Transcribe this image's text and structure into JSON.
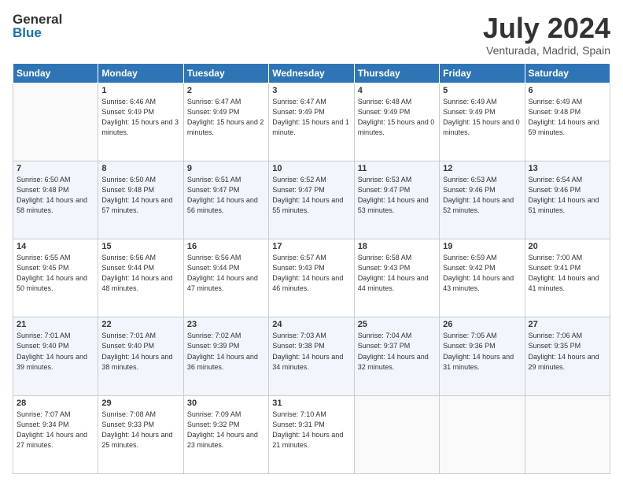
{
  "logo": {
    "general": "General",
    "blue": "Blue"
  },
  "title": "July 2024",
  "subtitle": "Venturada, Madrid, Spain",
  "days_of_week": [
    "Sunday",
    "Monday",
    "Tuesday",
    "Wednesday",
    "Thursday",
    "Friday",
    "Saturday"
  ],
  "weeks": [
    [
      {
        "day": "",
        "sunrise": "",
        "sunset": "",
        "daylight": ""
      },
      {
        "day": "1",
        "sunrise": "Sunrise: 6:46 AM",
        "sunset": "Sunset: 9:49 PM",
        "daylight": "Daylight: 15 hours and 3 minutes."
      },
      {
        "day": "2",
        "sunrise": "Sunrise: 6:47 AM",
        "sunset": "Sunset: 9:49 PM",
        "daylight": "Daylight: 15 hours and 2 minutes."
      },
      {
        "day": "3",
        "sunrise": "Sunrise: 6:47 AM",
        "sunset": "Sunset: 9:49 PM",
        "daylight": "Daylight: 15 hours and 1 minute."
      },
      {
        "day": "4",
        "sunrise": "Sunrise: 6:48 AM",
        "sunset": "Sunset: 9:49 PM",
        "daylight": "Daylight: 15 hours and 0 minutes."
      },
      {
        "day": "5",
        "sunrise": "Sunrise: 6:49 AM",
        "sunset": "Sunset: 9:49 PM",
        "daylight": "Daylight: 15 hours and 0 minutes."
      },
      {
        "day": "6",
        "sunrise": "Sunrise: 6:49 AM",
        "sunset": "Sunset: 9:48 PM",
        "daylight": "Daylight: 14 hours and 59 minutes."
      }
    ],
    [
      {
        "day": "7",
        "sunrise": "Sunrise: 6:50 AM",
        "sunset": "Sunset: 9:48 PM",
        "daylight": "Daylight: 14 hours and 58 minutes."
      },
      {
        "day": "8",
        "sunrise": "Sunrise: 6:50 AM",
        "sunset": "Sunset: 9:48 PM",
        "daylight": "Daylight: 14 hours and 57 minutes."
      },
      {
        "day": "9",
        "sunrise": "Sunrise: 6:51 AM",
        "sunset": "Sunset: 9:47 PM",
        "daylight": "Daylight: 14 hours and 56 minutes."
      },
      {
        "day": "10",
        "sunrise": "Sunrise: 6:52 AM",
        "sunset": "Sunset: 9:47 PM",
        "daylight": "Daylight: 14 hours and 55 minutes."
      },
      {
        "day": "11",
        "sunrise": "Sunrise: 6:53 AM",
        "sunset": "Sunset: 9:47 PM",
        "daylight": "Daylight: 14 hours and 53 minutes."
      },
      {
        "day": "12",
        "sunrise": "Sunrise: 6:53 AM",
        "sunset": "Sunset: 9:46 PM",
        "daylight": "Daylight: 14 hours and 52 minutes."
      },
      {
        "day": "13",
        "sunrise": "Sunrise: 6:54 AM",
        "sunset": "Sunset: 9:46 PM",
        "daylight": "Daylight: 14 hours and 51 minutes."
      }
    ],
    [
      {
        "day": "14",
        "sunrise": "Sunrise: 6:55 AM",
        "sunset": "Sunset: 9:45 PM",
        "daylight": "Daylight: 14 hours and 50 minutes."
      },
      {
        "day": "15",
        "sunrise": "Sunrise: 6:56 AM",
        "sunset": "Sunset: 9:44 PM",
        "daylight": "Daylight: 14 hours and 48 minutes."
      },
      {
        "day": "16",
        "sunrise": "Sunrise: 6:56 AM",
        "sunset": "Sunset: 9:44 PM",
        "daylight": "Daylight: 14 hours and 47 minutes."
      },
      {
        "day": "17",
        "sunrise": "Sunrise: 6:57 AM",
        "sunset": "Sunset: 9:43 PM",
        "daylight": "Daylight: 14 hours and 46 minutes."
      },
      {
        "day": "18",
        "sunrise": "Sunrise: 6:58 AM",
        "sunset": "Sunset: 9:43 PM",
        "daylight": "Daylight: 14 hours and 44 minutes."
      },
      {
        "day": "19",
        "sunrise": "Sunrise: 6:59 AM",
        "sunset": "Sunset: 9:42 PM",
        "daylight": "Daylight: 14 hours and 43 minutes."
      },
      {
        "day": "20",
        "sunrise": "Sunrise: 7:00 AM",
        "sunset": "Sunset: 9:41 PM",
        "daylight": "Daylight: 14 hours and 41 minutes."
      }
    ],
    [
      {
        "day": "21",
        "sunrise": "Sunrise: 7:01 AM",
        "sunset": "Sunset: 9:40 PM",
        "daylight": "Daylight: 14 hours and 39 minutes."
      },
      {
        "day": "22",
        "sunrise": "Sunrise: 7:01 AM",
        "sunset": "Sunset: 9:40 PM",
        "daylight": "Daylight: 14 hours and 38 minutes."
      },
      {
        "day": "23",
        "sunrise": "Sunrise: 7:02 AM",
        "sunset": "Sunset: 9:39 PM",
        "daylight": "Daylight: 14 hours and 36 minutes."
      },
      {
        "day": "24",
        "sunrise": "Sunrise: 7:03 AM",
        "sunset": "Sunset: 9:38 PM",
        "daylight": "Daylight: 14 hours and 34 minutes."
      },
      {
        "day": "25",
        "sunrise": "Sunrise: 7:04 AM",
        "sunset": "Sunset: 9:37 PM",
        "daylight": "Daylight: 14 hours and 32 minutes."
      },
      {
        "day": "26",
        "sunrise": "Sunrise: 7:05 AM",
        "sunset": "Sunset: 9:36 PM",
        "daylight": "Daylight: 14 hours and 31 minutes."
      },
      {
        "day": "27",
        "sunrise": "Sunrise: 7:06 AM",
        "sunset": "Sunset: 9:35 PM",
        "daylight": "Daylight: 14 hours and 29 minutes."
      }
    ],
    [
      {
        "day": "28",
        "sunrise": "Sunrise: 7:07 AM",
        "sunset": "Sunset: 9:34 PM",
        "daylight": "Daylight: 14 hours and 27 minutes."
      },
      {
        "day": "29",
        "sunrise": "Sunrise: 7:08 AM",
        "sunset": "Sunset: 9:33 PM",
        "daylight": "Daylight: 14 hours and 25 minutes."
      },
      {
        "day": "30",
        "sunrise": "Sunrise: 7:09 AM",
        "sunset": "Sunset: 9:32 PM",
        "daylight": "Daylight: 14 hours and 23 minutes."
      },
      {
        "day": "31",
        "sunrise": "Sunrise: 7:10 AM",
        "sunset": "Sunset: 9:31 PM",
        "daylight": "Daylight: 14 hours and 21 minutes."
      },
      {
        "day": "",
        "sunrise": "",
        "sunset": "",
        "daylight": ""
      },
      {
        "day": "",
        "sunrise": "",
        "sunset": "",
        "daylight": ""
      },
      {
        "day": "",
        "sunrise": "",
        "sunset": "",
        "daylight": ""
      }
    ]
  ]
}
